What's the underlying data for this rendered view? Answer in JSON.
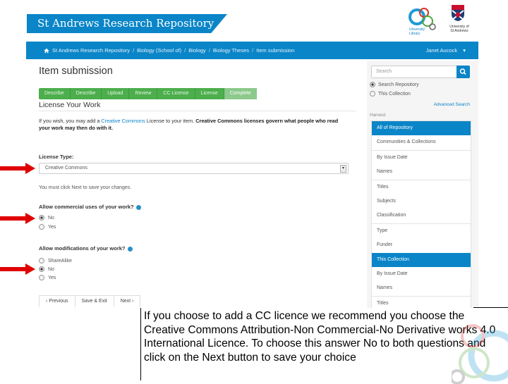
{
  "header": {
    "site_title": "St Andrews Research Repository",
    "library_logo_text": "University Library",
    "crest_text": "University of St Andrews"
  },
  "navbar": {
    "breadcrumb": [
      "St Andrews Research Repository",
      "Biology (School of)",
      "Biology",
      "Biology Theses",
      "Item submission"
    ],
    "separator": "/",
    "user_name": "Janet Aucock",
    "user_menu_caret": "▾"
  },
  "main": {
    "page_title": "Item submission",
    "steps": [
      {
        "label": "Describe",
        "active": false
      },
      {
        "label": "Describe",
        "active": false
      },
      {
        "label": "Upload",
        "active": false
      },
      {
        "label": "Review",
        "active": false
      },
      {
        "label": "CC License",
        "active": false
      },
      {
        "label": "License",
        "active": false
      },
      {
        "label": "Complete",
        "active": true
      }
    ],
    "section_heading": "License Your Work",
    "intro_prefix": "If you wish, you may add a ",
    "intro_link": "Creative Commons",
    "intro_middle": " License to your item. ",
    "intro_bold": "Creative Commons licenses govern what people who read your work may then do with it.",
    "license_type_label": "License Type:",
    "license_type_value": "Creative Commons",
    "save_hint": "You must click Next to save your changes.",
    "commercial_question": "Allow commercial uses of your work?",
    "commercial_options": [
      {
        "label": "No",
        "checked": true
      },
      {
        "label": "Yes",
        "checked": false
      }
    ],
    "modifications_question": "Allow modifications of your work?",
    "modifications_options": [
      {
        "label": "ShareAlike",
        "checked": false
      },
      {
        "label": "No",
        "checked": true
      },
      {
        "label": "Yes",
        "checked": false
      }
    ],
    "buttons": {
      "previous": "‹ Previous",
      "save_exit": "Save & Exit",
      "next": "Next ›"
    }
  },
  "sidebar": {
    "search_placeholder": "Search",
    "scope_options": [
      {
        "label": "Search Repository",
        "checked": true
      },
      {
        "label": "This Collection",
        "checked": false
      }
    ],
    "advanced_search": "Advanced Search",
    "harvest_label": "Harvest",
    "nav_items": [
      {
        "label": "All of Repository",
        "active": true
      },
      {
        "label": "Communities & Collections",
        "active": false
      },
      {
        "label": "By Issue Date",
        "active": false
      },
      {
        "label": "Names",
        "active": false
      },
      {
        "label": "Titles",
        "active": false
      },
      {
        "label": "Subjects",
        "active": false
      },
      {
        "label": "Classification",
        "active": false
      },
      {
        "label": "Type",
        "active": false
      },
      {
        "label": "Funder",
        "active": false
      },
      {
        "label": "This Collection",
        "active": true
      },
      {
        "label": "By Issue Date",
        "active": false
      },
      {
        "label": "Names",
        "active": false
      },
      {
        "label": "Titles",
        "active": false
      }
    ]
  },
  "callout": {
    "text": "If you choose to add a CC licence we recommend you choose the Creative Commons Attribution-Non Commercial-No Derivative works 4.0 International Licence. To choose this answer No to both questions and click on the Next button to save your choice"
  },
  "colors": {
    "brand_blue": "#0a85c8",
    "step_green": "#4cae4c",
    "step_active": "#8cc98c",
    "annotation_arrow_red": "#e00000"
  }
}
